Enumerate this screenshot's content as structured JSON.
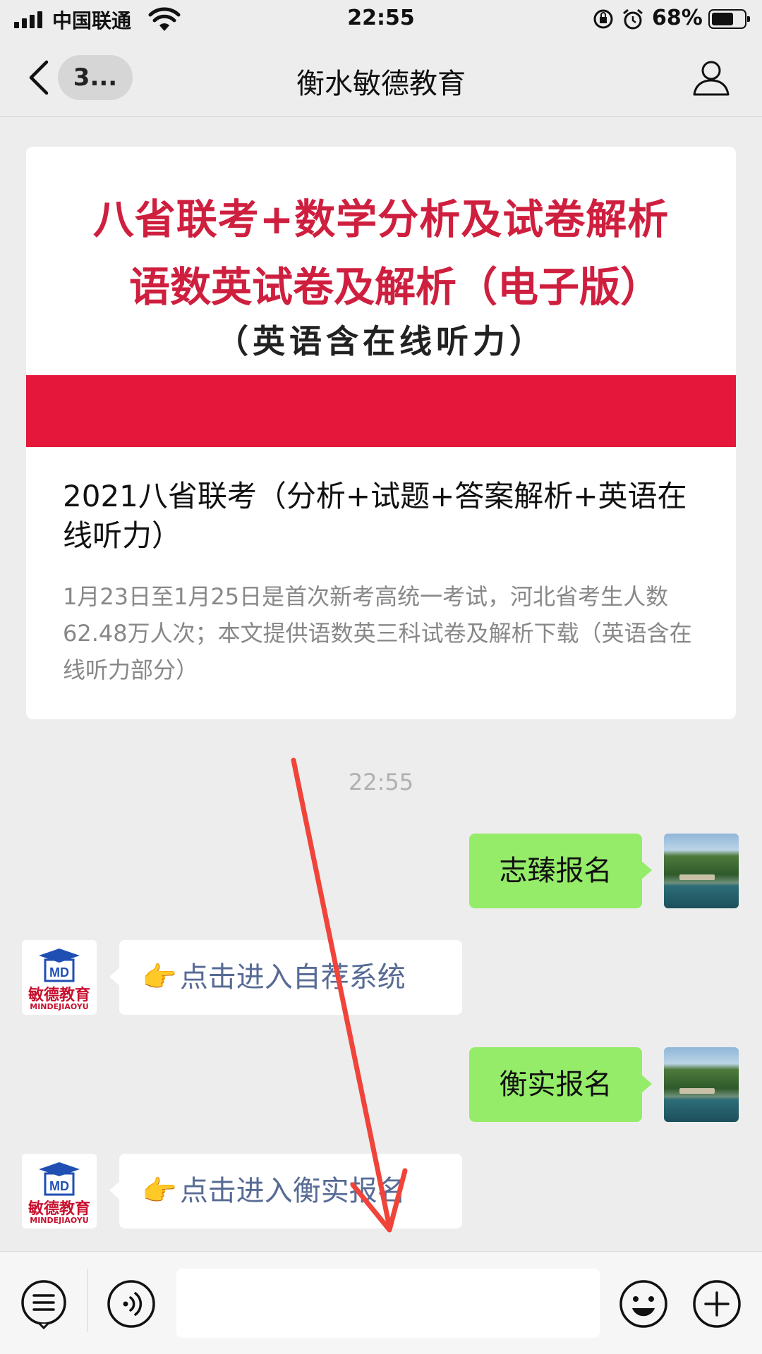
{
  "status_bar": {
    "carrier": "中国联通",
    "time": "22:55",
    "battery_percent": "68%",
    "battery_level": 0.68,
    "icons": [
      "signal-icon",
      "wifi-icon",
      "orientation-lock-icon",
      "alarm-icon",
      "battery-icon"
    ]
  },
  "nav": {
    "back_icon": "chevron-left-icon",
    "unread_count": "3...",
    "title": "衡水敏德教育",
    "profile_icon": "person-icon"
  },
  "article_card": {
    "cover": {
      "line1": "八省联考+数学分析及试卷解析",
      "line2": "语数英试卷及解析（电子版）",
      "line3": "（英语含在线听力）"
    },
    "title": "2021八省联考（分析+试题+答案解析+英语在线听力）",
    "description": "1月23日至1月25日是首次新考高统一考试，河北省考生人数62.48万人次；本文提供语数英三科试卷及解析下载（英语含在线听力部分）"
  },
  "timestamp": "22:55",
  "messages": [
    {
      "side": "right",
      "text": "志臻报名"
    },
    {
      "side": "left",
      "emoji": "👉",
      "text": "点击进入自荐系统"
    },
    {
      "side": "right",
      "text": "衡实报名"
    },
    {
      "side": "left",
      "emoji": "👉",
      "text": "点击进入衡实报名"
    }
  ],
  "account_logo": {
    "name_cn": "敏德教育",
    "name_en": "MINDEJIAOYU",
    "mark": "MD"
  },
  "input_bar": {
    "icons": [
      "menu-list-icon",
      "voice-icon",
      "emoji-icon",
      "plus-icon"
    ],
    "placeholder": ""
  },
  "colors": {
    "accent_red": "#e5183c",
    "bubble_green": "#95ec69",
    "link_blue": "#576b95",
    "annotation_arrow": "#f0443a"
  }
}
